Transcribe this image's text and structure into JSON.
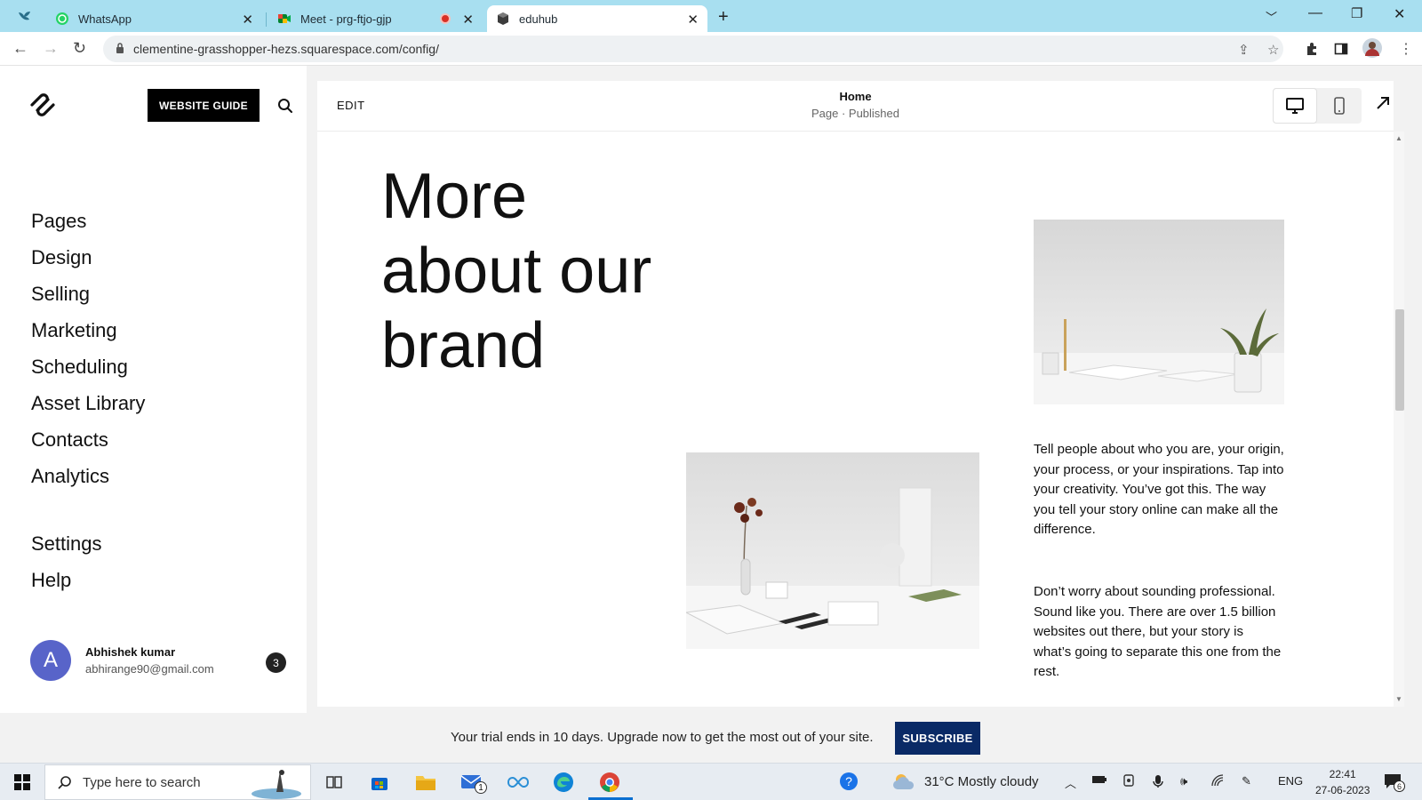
{
  "browser": {
    "tabs": [
      {
        "title": "WhatsApp"
      },
      {
        "title": "Meet - prg-ftjo-gjp"
      },
      {
        "title": "eduhub"
      }
    ],
    "url": "clementine-grasshopper-hezs.squarespace.com/config/"
  },
  "sidebar": {
    "guide_button": "WEBSITE GUIDE",
    "nav": [
      {
        "label": "Pages"
      },
      {
        "label": "Design"
      },
      {
        "label": "Selling"
      },
      {
        "label": "Marketing"
      },
      {
        "label": "Scheduling"
      },
      {
        "label": "Asset Library"
      },
      {
        "label": "Contacts"
      },
      {
        "label": "Analytics"
      },
      {
        "label": "Settings"
      },
      {
        "label": "Help"
      }
    ],
    "user": {
      "initial": "A",
      "name": "Abhishek kumar",
      "email": "abhirange90@gmail.com",
      "notifications": "3"
    }
  },
  "editor": {
    "edit_label": "EDIT",
    "page_title": "Home",
    "page_status": "Page · Published",
    "heading_lines": [
      "More",
      "about our",
      "brand"
    ],
    "paragraphs": [
      "Tell people about who you are, your origin, your process,  or your inspirations. Tap into your creativity. You’ve got this. The way you tell your story online can make all the difference.",
      "Don’t worry about sounding professional. Sound like you. There are over 1.5 billion websites out there, but your story is what’s going to separate this one from the rest."
    ]
  },
  "trial": {
    "message": "Your trial ends in 10 days. Upgrade now to get the most out of your site.",
    "button": "SUBSCRIBE"
  },
  "taskbar": {
    "search_placeholder": "Type here to search",
    "mail_badge": "1",
    "weather": "31°C  Mostly cloudy",
    "language": "ENG",
    "time": "22:41",
    "date": "27-06-2023",
    "notification_count": "6"
  },
  "colors": {
    "tab_strip": "#a8dff0",
    "subscribe_button": "#0a2a66",
    "avatar": "#5864c9"
  }
}
